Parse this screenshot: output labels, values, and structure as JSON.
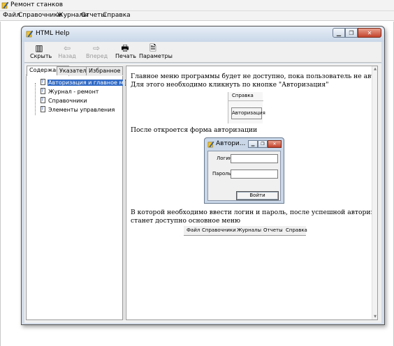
{
  "app": {
    "title": "Ремонт станков",
    "menu": [
      "Файл",
      "Справочники",
      "Журналы",
      "Отчеты",
      "Справка"
    ]
  },
  "help": {
    "title": "HTML Help",
    "toolbar": {
      "hide": "Скрыть",
      "back": "Назад",
      "forward": "Вперед",
      "print": "Печать",
      "options": "Параметры"
    },
    "tabs": [
      "Содержание",
      "Указатель",
      "Избранное"
    ],
    "tree": [
      "Авторизация и главное меню",
      "Журнал - ремонт",
      "Справочники",
      "Элементы управления"
    ],
    "selected_index": 0
  },
  "content": {
    "line1": "Главное меню программы будет не доступно, пока пользователь не авторизуется.",
    "line2": "Для этого необходимо кликнуть по кнопке \"Авторизация\"",
    "spravka_menu": "Справка",
    "auth_button": "Авторизация",
    "line3": "После откроется форма авторизации",
    "auth_dialog": {
      "title": "Автори...",
      "login_label": "Логин",
      "password_label": "Пароль",
      "ok_button": "Войти"
    },
    "line4": "В которой необходимо ввести логин и пароль, после успешной авторизации",
    "line5": "станет доступно основное меню",
    "main_menu": [
      "Файл",
      "Справочники",
      "Журналы",
      "Отчеты",
      "Справка"
    ]
  },
  "icons": {
    "app": "app-pencil-icon",
    "hide": "hide-pane-icon",
    "back": "back-arrow-icon",
    "forward": "forward-arrow-icon",
    "print": "printer-icon",
    "options": "options-icon",
    "topic": "help-topic-icon"
  },
  "colors": {
    "selection": "#316ac5",
    "close_button": "#c2432c",
    "window_frame": "#c9d7e8"
  }
}
